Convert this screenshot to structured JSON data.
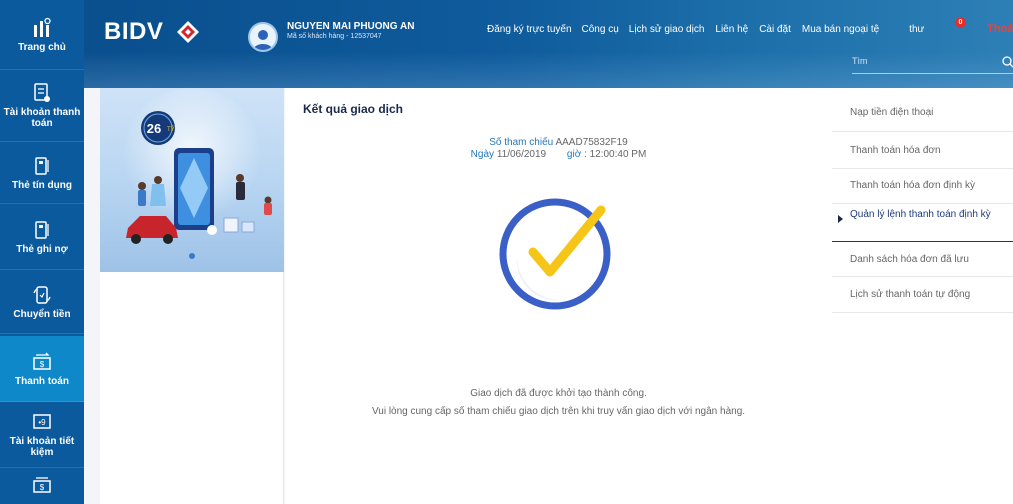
{
  "sidebar": {
    "items": [
      {
        "label": "Trang chủ",
        "icon": "home-icon"
      },
      {
        "label": "Tài khoản thanh toán",
        "icon": "account-icon"
      },
      {
        "label": "Thẻ tín dụng",
        "icon": "credit-card-icon"
      },
      {
        "label": "Thẻ ghi nợ",
        "icon": "debit-card-icon"
      },
      {
        "label": "Chuyển tiền",
        "icon": "transfer-icon"
      },
      {
        "label": "Thanh toán",
        "icon": "payment-icon"
      },
      {
        "label": "Tài khoản tiết kiệm",
        "icon": "savings-icon"
      },
      {
        "label": "",
        "icon": "money-icon"
      }
    ],
    "active_index": 5
  },
  "header": {
    "logo": "BIDV",
    "user_name": "NGUYEN MAI PHUONG AN",
    "customer_id": "Mã số khách hàng - 12537047",
    "nav": [
      "Đăng ký trực tuyến",
      "Công cụ",
      "Lịch sử giao dịch",
      "Liên hệ",
      "Cài đặt",
      "Mua bán ngoại tệ",
      "thư"
    ],
    "mail_badge": "0",
    "logout": "Thoát",
    "search_placeholder": "Tìm"
  },
  "banner": {
    "badge_text": "26"
  },
  "main": {
    "title": "Kết quả giao dịch",
    "ref_label": "Số tham chiếu",
    "ref_value": "AAAD75832F19",
    "date_label": "Ngày",
    "date_value": "11/06/2019",
    "time_label": "giờ :",
    "time_value": "12:00:40 PM",
    "success_message": "Giao dịch đã được khởi tạo thành công.",
    "note": "Vui lòng cung cấp số tham chiếu giao dịch trên khi truy vấn giao dịch với ngân hàng."
  },
  "right_menu": {
    "items": [
      "Nạp tiền điện thoại",
      "Thanh toán hóa đơn",
      "Thanh toán hóa đơn định kỳ",
      "Quản lý lệnh thanh toán định kỳ",
      "Danh sách hóa đơn đã lưu",
      "Lịch sử thanh toán tự động"
    ],
    "active_index": 3
  },
  "colors": {
    "sidebar": "#0b5a9e",
    "sidebar_active": "#0e88c9",
    "check_ring": "#3a5fc7",
    "check_mark": "#f5c518",
    "logout": "#ff3b30"
  }
}
